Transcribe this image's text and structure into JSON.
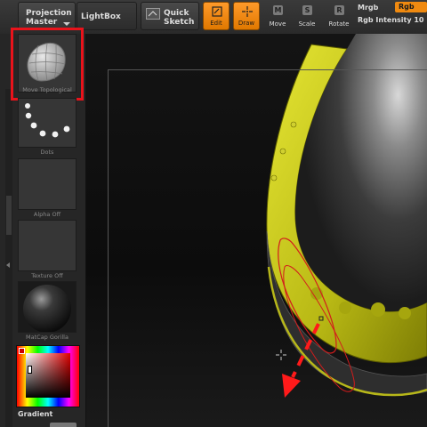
{
  "toolbar": {
    "projection_master": [
      "Projection",
      "Master"
    ],
    "lightbox": "LightBox",
    "quick_sketch": [
      "Quick",
      "Sketch"
    ],
    "edit": "Edit",
    "draw": "Draw",
    "move": "Move",
    "scale": "Scale",
    "rotate": "Rotate",
    "move_key": "M",
    "scale_key": "S",
    "rotate_key": "R",
    "mrgb": "Mrgb",
    "rgb": "Rgb",
    "rgb_intensity": "Rgb Intensity 10"
  },
  "sidebar": {
    "brush_label": "Move Topological",
    "stroke_label": "Dots",
    "alpha_label": "Alpha Off",
    "texture_label": "Texture Off",
    "material_label": "MatCap Gorilla",
    "gradient_label": "Gradient"
  },
  "colors": {
    "accent_orange": "#f08a10",
    "highlight_red": "#e8131b",
    "mesh_yellow": "#c8c81a"
  }
}
